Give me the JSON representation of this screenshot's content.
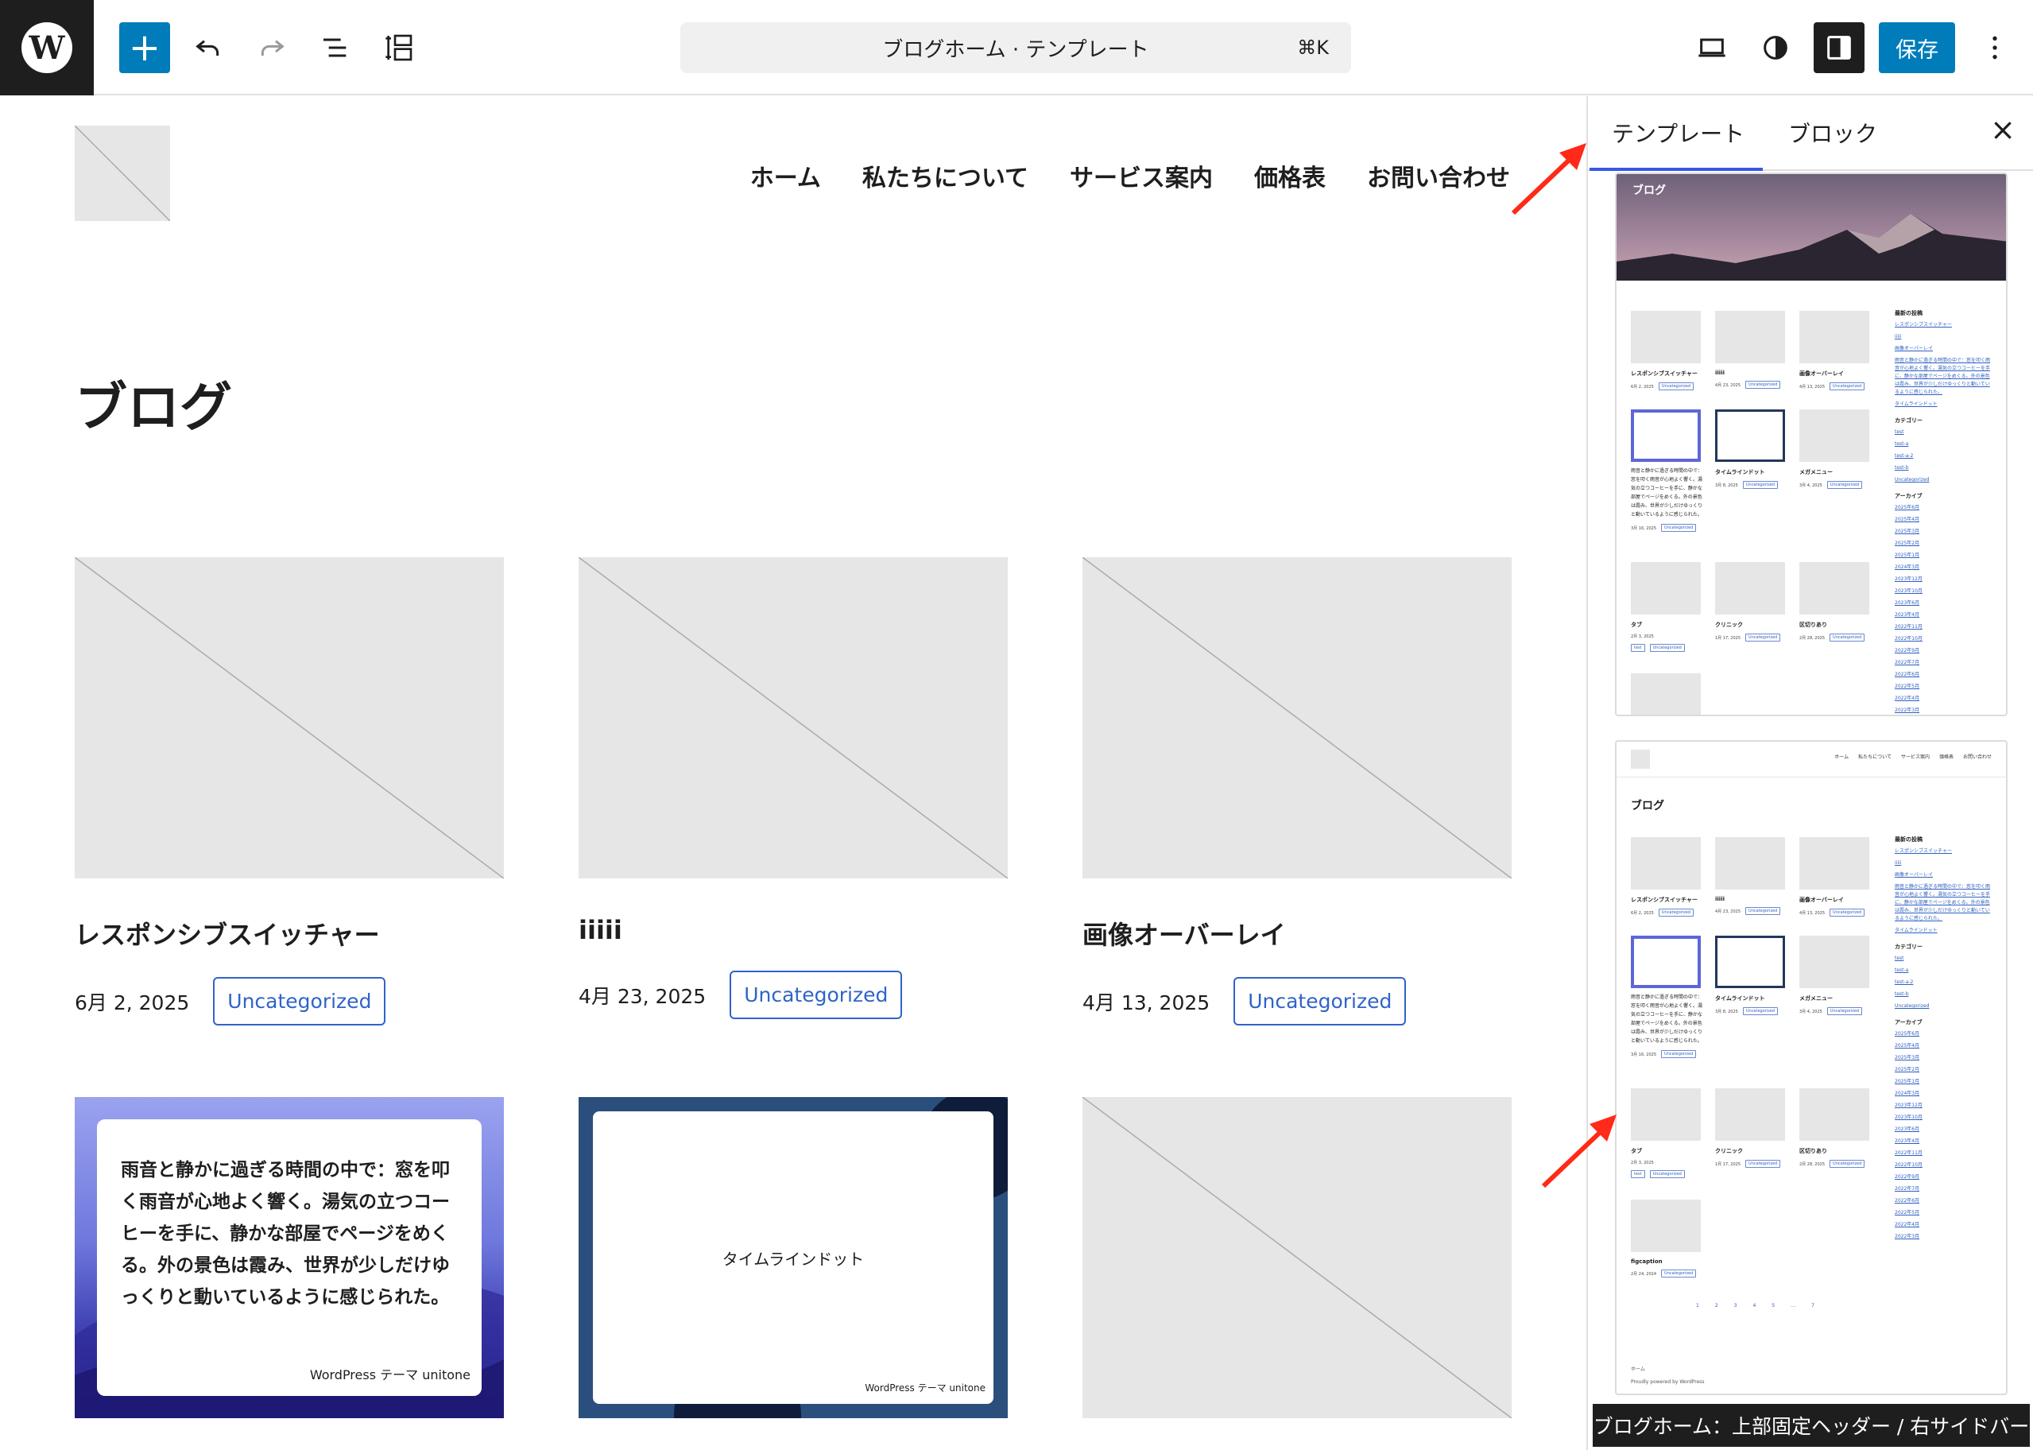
{
  "toolbar": {
    "document_title": "ブログホーム · テンプレート",
    "shortcut": "⌘K",
    "save_label": "保存"
  },
  "site": {
    "nav": [
      "ホーム",
      "私たちについて",
      "サービス案内",
      "価格表",
      "お問い合わせ"
    ],
    "page_title": "ブログ"
  },
  "posts": [
    {
      "title": "レスポンシブスイッチャー",
      "date": "6月 2, 2025",
      "category": "Uncategorized"
    },
    {
      "title": "iiiii",
      "date": "4月 23, 2025",
      "category": "Uncategorized"
    },
    {
      "title": "画像オーバーレイ",
      "date": "4月 13, 2025",
      "category": "Uncategorized"
    }
  ],
  "thumb_cards": {
    "rain_text": "雨音と静かに過ぎる時間の中で：窓を叩く雨音が心地よく響く。湯気の立つコーヒーを手に、静かな部屋でページをめくる。外の景色は霞み、世界が少しだけゆっくりと動いているように感じられた。",
    "rain_footer": "WordPress テーマ unitone",
    "timeline_text": "タイムラインドット",
    "timeline_footer": "WordPress テーマ unitone"
  },
  "sidebar": {
    "tabs": [
      "テンプレート",
      "ブロック"
    ],
    "close_label": "×",
    "tooltip": "ブログホーム：上部固定ヘッダー / 右サイドバー"
  },
  "preview": {
    "hero_label": "ブログ",
    "page_title": "ブログ",
    "nav": [
      "ホーム",
      "私たちについて",
      "サービス案内",
      "価格表",
      "お問い合わせ"
    ],
    "posts_row1": [
      {
        "title": "レスポンシブスイッチャー",
        "date": "6月 2, 2025",
        "tag": "Uncategorized"
      },
      {
        "title": "iiiii",
        "date": "4月 23, 2025",
        "tag": "Uncategorized"
      },
      {
        "title": "画像オーバーレイ",
        "date": "4月 13, 2025",
        "tag": "Uncategorized"
      }
    ],
    "posts_row2": [
      {
        "title": "雨音と静かに過ぎる時間の中で：窓を叩く雨音が心地よく響く。湯気の立つコーヒーを手に、静かな部屋でページをめくる。外の景色は霞み、世界が少しだけゆっくりと動いているように感じられた。",
        "date": "3月 16, 2025",
        "tag": "Uncategorized"
      },
      {
        "title": "タイムラインドット",
        "date": "3月 8, 2025",
        "tag": "Uncategorized"
      },
      {
        "title": "メガメニュー",
        "date": "3月 4, 2025",
        "tag": "Uncategorized"
      }
    ],
    "posts_row3": [
      {
        "title": "タブ",
        "date": "2月 3, 2025",
        "tag": "Uncategorized",
        "tag2": "test"
      },
      {
        "title": "クリニック",
        "date": "1月 17, 2025",
        "tag": "Uncategorized"
      },
      {
        "title": "区切りあり",
        "date": "2月 28, 2025",
        "tag": "Uncategorized"
      }
    ],
    "post_row4": {
      "title": "figcaption",
      "date": "2月 24, 2024",
      "tag": "Uncategorized"
    },
    "side_recent_heading": "最新の投稿",
    "side_recent": [
      "レスポンシブスイッチャー",
      "iiiii",
      "画像オーバーレイ",
      "雨音と静かに過ぎる時間の中で：窓を叩く雨音が心地よく響く。湯気の立つコーヒーを手に、静かな部屋でページをめくる。外の景色は霞み、世界が少しだけゆっくりと動いているように感じられた。",
      "タイムラインドット"
    ],
    "side_category_heading": "カテゴリー",
    "side_categories": [
      "test",
      "test-a",
      "test-a-2",
      "test-b",
      "Uncategorized"
    ],
    "side_archive_heading": "アーカイブ",
    "side_archives": [
      "2025年6月",
      "2025年4月",
      "2025年3月",
      "2025年2月",
      "2025年1月",
      "2024年3月",
      "2023年12月",
      "2023年10月",
      "2023年6月",
      "2023年4月",
      "2022年11月",
      "2022年10月",
      "2022年9月",
      "2022年7月",
      "2022年6月",
      "2022年5月",
      "2022年4月",
      "2022年3月"
    ],
    "pager": [
      "1",
      "2",
      "3",
      "4",
      "5",
      "…",
      "7"
    ],
    "footer_home": "ホーム",
    "footer_credit": "Proudly powered by WordPress"
  }
}
